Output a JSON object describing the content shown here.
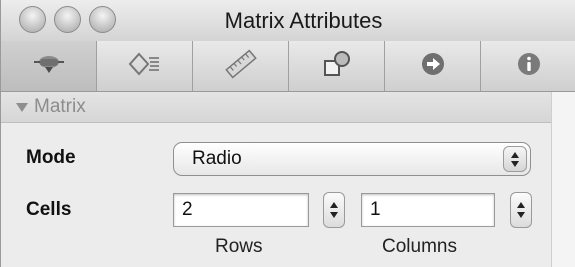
{
  "window": {
    "title": "Matrix Attributes"
  },
  "toolbar": {
    "tabs": [
      {
        "icon": "attributes-icon"
      },
      {
        "icon": "effects-icon"
      },
      {
        "icon": "size-ruler-icon"
      },
      {
        "icon": "connections-icon"
      },
      {
        "icon": "bindings-arrow-icon"
      },
      {
        "icon": "identity-info-icon"
      }
    ]
  },
  "section": {
    "title": "Matrix"
  },
  "mode": {
    "label": "Mode",
    "value": "Radio"
  },
  "cells": {
    "label": "Cells",
    "rows_value": "2",
    "columns_value": "1",
    "rows_label": "Rows",
    "columns_label": "Columns"
  }
}
